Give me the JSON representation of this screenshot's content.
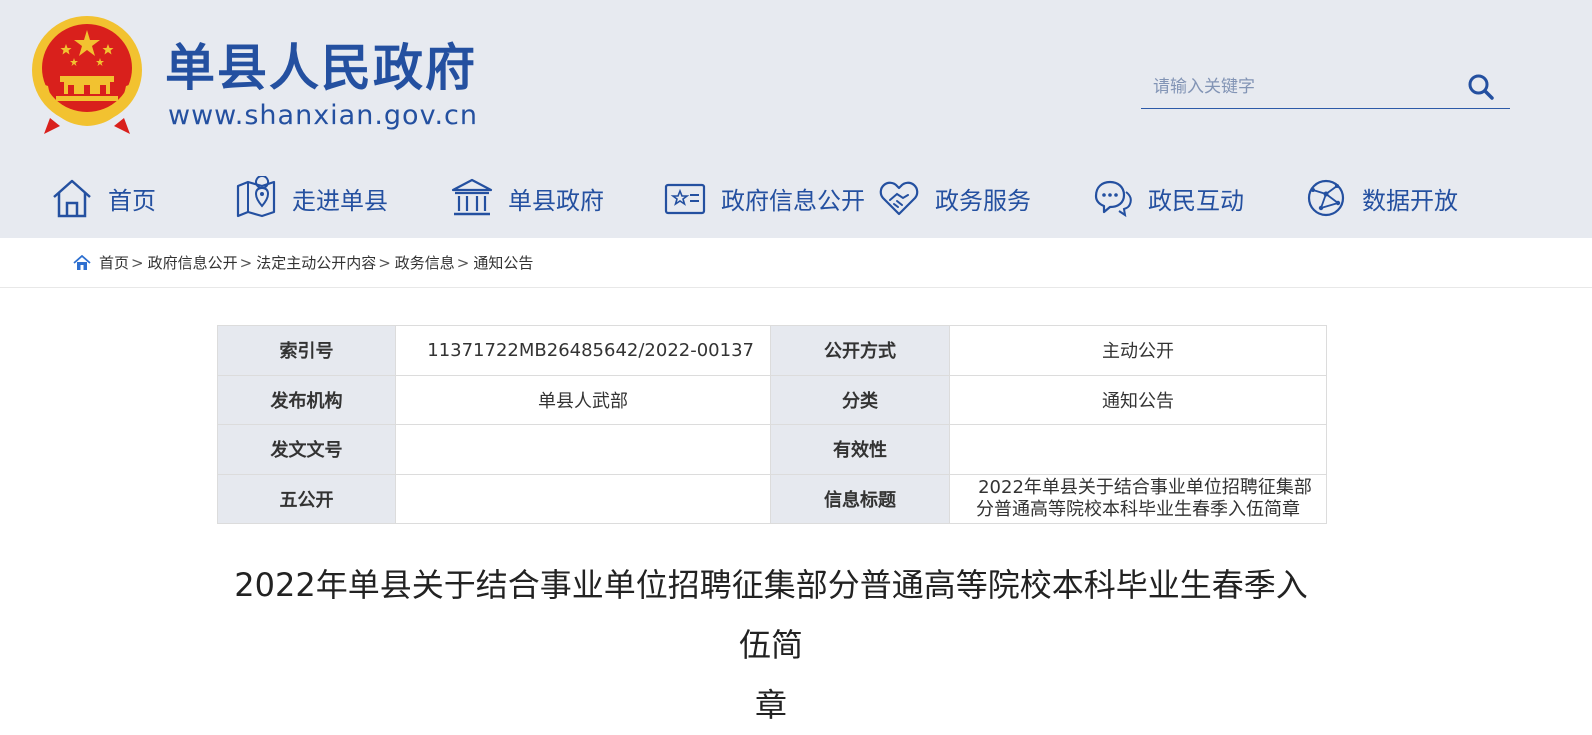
{
  "header": {
    "site_name": "单县人民政府",
    "site_url": "www.shanxian.gov.cn",
    "search_placeholder": "请输入关键字",
    "colors": {
      "brand_blue": "#2450a0",
      "header_bg": "#e7eaf0",
      "emblem_red": "#d9201c",
      "emblem_gold": "#f2c230"
    }
  },
  "nav": {
    "items": [
      {
        "label": "首页",
        "icon": "home-icon"
      },
      {
        "label": "走进单县",
        "icon": "map-icon"
      },
      {
        "label": "单县政府",
        "icon": "government-building-icon"
      },
      {
        "label": "政府信息公开",
        "icon": "info-card-icon"
      },
      {
        "label": "政务服务",
        "icon": "handshake-icon"
      },
      {
        "label": "政民互动",
        "icon": "chat-icon"
      },
      {
        "label": "数据开放",
        "icon": "globe-network-icon"
      }
    ]
  },
  "breadcrumb": {
    "items": [
      "首页",
      "政府信息公开",
      "法定主动公开内容",
      "政务信息",
      "通知公告"
    ],
    "separator": ">"
  },
  "meta_table": {
    "rows": [
      {
        "label1": "索引号",
        "value1": "11371722MB26485642/2022-00137",
        "label2": "公开方式",
        "value2": "主动公开"
      },
      {
        "label1": "发布机构",
        "value1": "单县人武部",
        "label2": "分类",
        "value2": "通知公告"
      },
      {
        "label1": "发文文号",
        "value1": "",
        "label2": "有效性",
        "value2": ""
      },
      {
        "label1": "五公开",
        "value1": "",
        "label2": "信息标题",
        "value2_line1": "2022年单县关于结合事业单位招聘征集部",
        "value2_line2": "分普通高等院校本科毕业生春季入伍简章"
      }
    ]
  },
  "article": {
    "title_line1": "2022年单县关于结合事业单位招聘征集部分普通高等院校本科毕业生春季入伍简",
    "title_line2": "章"
  }
}
